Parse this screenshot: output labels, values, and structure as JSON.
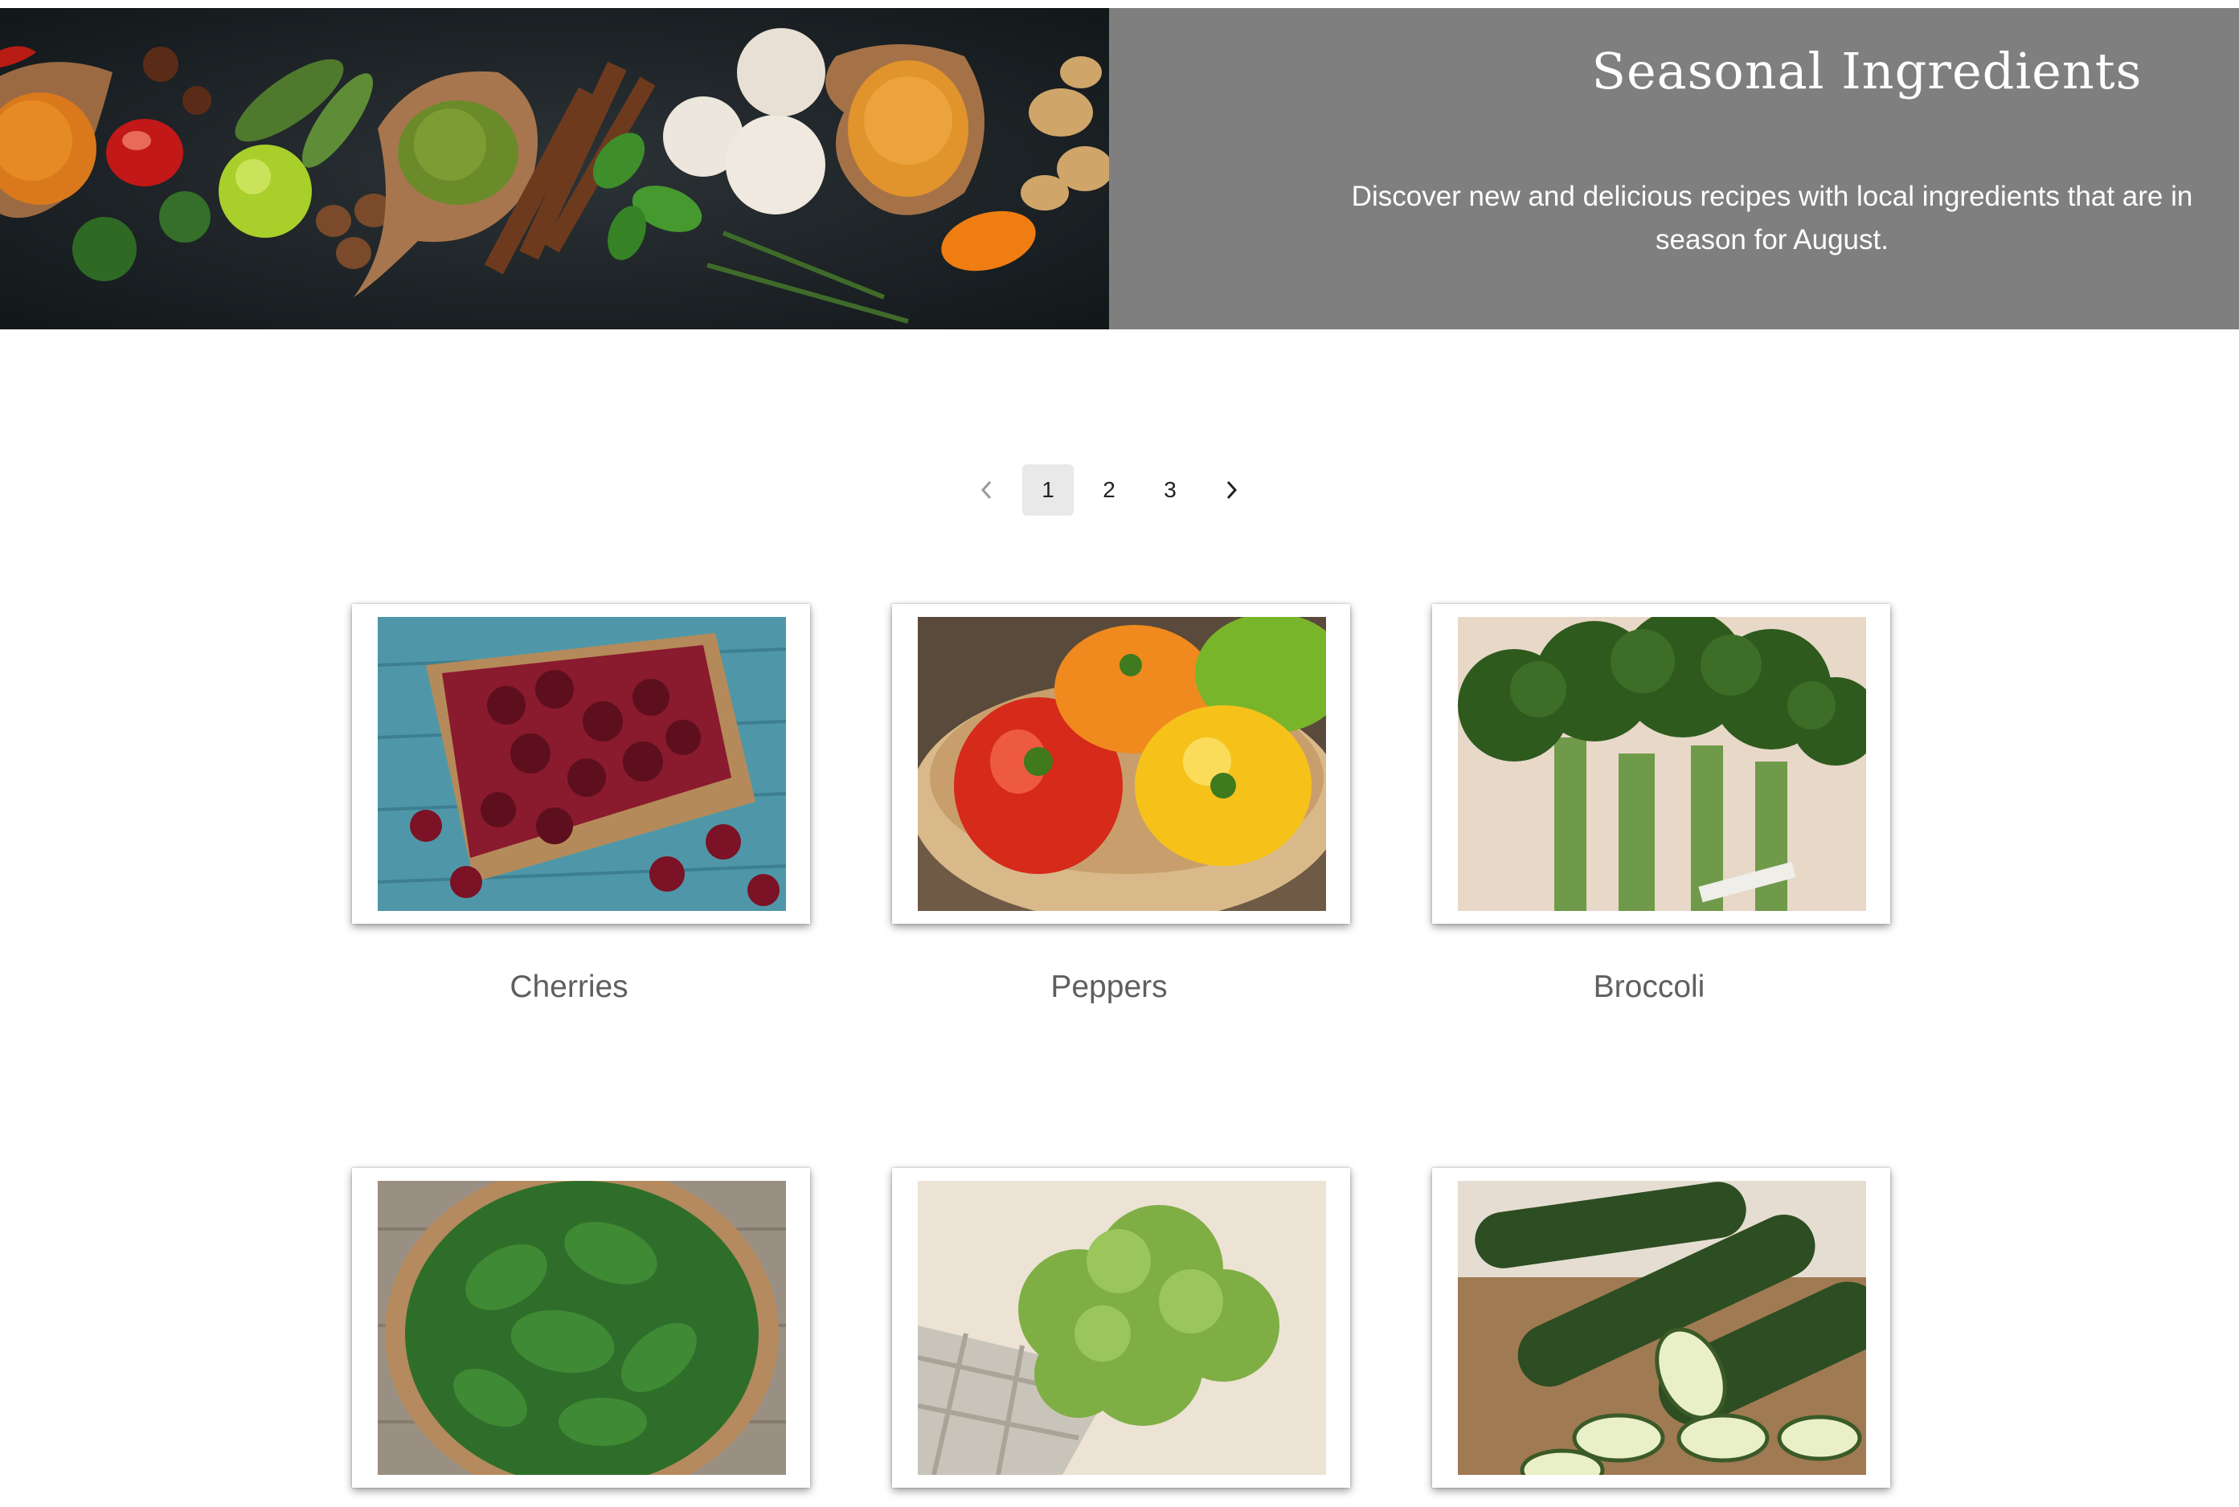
{
  "hero": {
    "image_alt_icon": "spices-banner-image",
    "title": "Seasonal Ingredients",
    "description": "Discover new and delicious recipes with local ingredients that are in season for August.",
    "panel_color": "#7f7f7f"
  },
  "pagination": {
    "prev_icon": "chevron-left-icon",
    "pages": [
      "1",
      "2",
      "3"
    ],
    "current": "1",
    "next_icon": "chevron-right-icon"
  },
  "ingredients": [
    {
      "name": "Cherries",
      "icon": "cherries-image"
    },
    {
      "name": "Peppers",
      "icon": "peppers-image"
    },
    {
      "name": "Broccoli",
      "icon": "broccoli-image"
    },
    {
      "name": "",
      "icon": "spinach-image"
    },
    {
      "name": "",
      "icon": "lettuce-image"
    },
    {
      "name": "",
      "icon": "zucchini-image"
    }
  ]
}
